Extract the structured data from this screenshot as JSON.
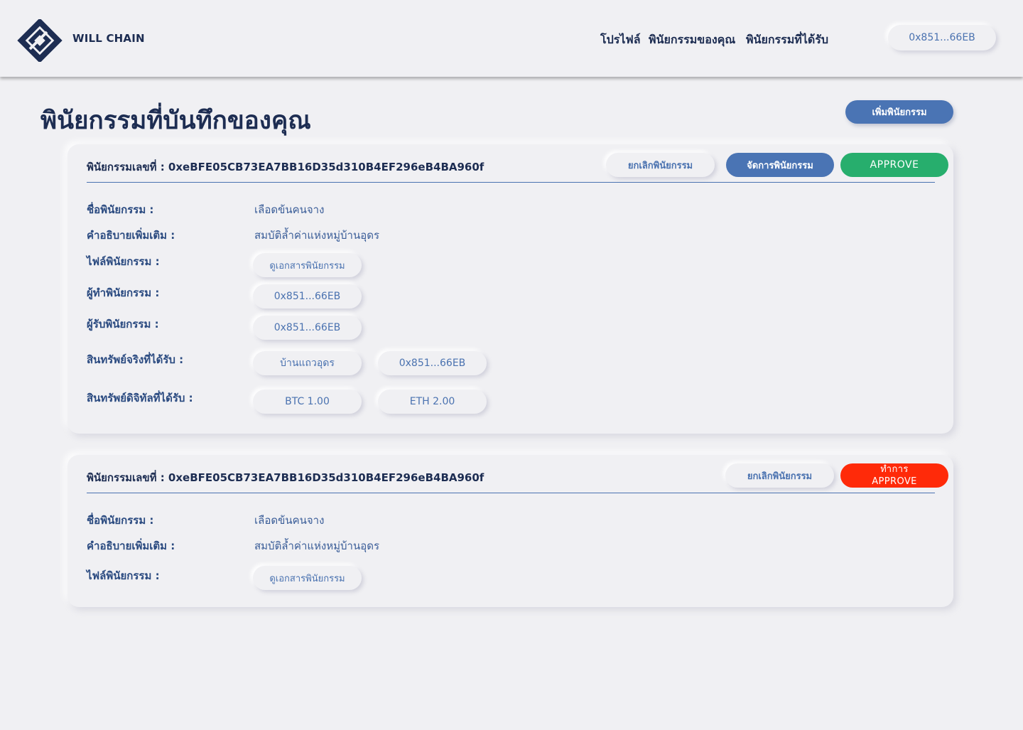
{
  "brand": {
    "name": "WILL CHAIN"
  },
  "nav": {
    "profile": "โปรไฟล์",
    "my_wills": "พินัยกรรมของคุณ",
    "received_wills": "พินัยกรรมที่ได้รับ",
    "wallet": "0x851...66EB"
  },
  "page": {
    "title": "พินัยกรรมที่บันทึกของคุณ",
    "add_button": "เพิ่มพินัยกรรม"
  },
  "labels": {
    "will_name": "ชื่อพินัยกรรม :",
    "description": "คำอธิบายเพิ่มเติม :",
    "file": "ไฟล์พินัยกรรม :",
    "testator": "ผู้ทำพินัยกรรม :",
    "beneficiary": "ผู้รับพินัยกรรม :",
    "real_assets": "สินทรัพย์จริงที่ได้รับ :",
    "digital_assets": "สินทรัพย์ดิจิทัลที่ได้รับ :"
  },
  "wills": [
    {
      "header": "พินัยกรรมเลขที่ : 0xeBFE05CB73EA7BB16D35d310B4EF296eB4BA960f",
      "cancel": "ยกเลิกพินัยกรรม",
      "manage": "จัดการพินัยกรรม",
      "approve": "APPROVE",
      "name": "เลือดข้นคนจาง",
      "description": "สมบัติล้ำค่าแห่งหมู่บ้านอุดร",
      "file_button": "ดูเอกสารพินัยกรรม",
      "testator": "0x851...66EB",
      "beneficiary": "0x851...66EB",
      "real_assets": [
        "บ้านแถวอุดร",
        "0x851...66EB"
      ],
      "digital_assets": [
        "BTC 1.00",
        "ETH 2.00"
      ]
    },
    {
      "header": "พินัยกรรมเลขที่ : 0xeBFE05CB73EA7BB16D35d310B4EF296eB4BA960f",
      "cancel": "ยกเลิกพินัยกรรม",
      "approve_line1": "ทำการ",
      "approve_line2": "APPROVE",
      "name": "เลือดข้นคนจาง",
      "description": "สมบัติล้ำค่าแห่งหมู่บ้านอุดร",
      "file_button": "ดูเอกสารพินัยกรรม"
    }
  ],
  "colors": {
    "background": "#f0f0f3",
    "navy": "#1d2d52",
    "accent_blue": "#4a74b4",
    "approve_green": "#27ae6d",
    "approve_red": "#ff2a09"
  },
  "icons": {
    "logo": "will-chain-logo-icon"
  }
}
